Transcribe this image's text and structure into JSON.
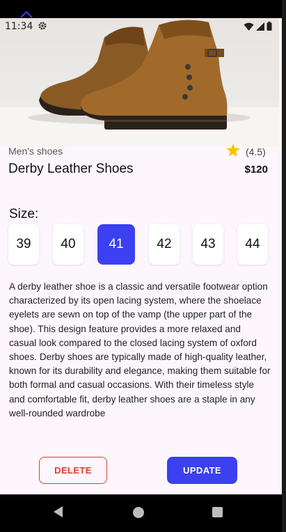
{
  "status_bar": {
    "time": "11:34",
    "icons": [
      "settings-icon",
      "wifi-icon",
      "signal-icon",
      "battery-icon"
    ]
  },
  "product": {
    "category": "Men's shoes",
    "rating": "(4.5)",
    "name": "Derby Leather Shoes",
    "price": "$120",
    "image": "brown-leather-boots"
  },
  "size_section": {
    "label": "Size:",
    "options": [
      "39",
      "40",
      "41",
      "42",
      "43",
      "44"
    ],
    "selected": "41"
  },
  "description": "A derby leather shoe is a classic and versatile footwear option characterized by its open lacing system, where the shoelace eyelets are sewn on top of the vamp (the upper part of the shoe). This design feature provides a more relaxed and casual look compared to the closed lacing system of oxford shoes. Derby shoes are typically made of high-quality leather, known for its durability and elegance, making them suitable for both formal and casual occasions. With their timeless style and comfortable fit, derby leather shoes are a staple in any well-rounded wardrobe",
  "actions": {
    "delete_label": "DELETE",
    "update_label": "UPDATE"
  },
  "colors": {
    "accent": "#3b40f0",
    "danger": "#e23a2f",
    "star": "#f6c200",
    "background": "#fdf7fd"
  },
  "nav_bar": {
    "icons": [
      "back-triangle-icon",
      "home-circle-icon",
      "recents-square-icon"
    ]
  }
}
